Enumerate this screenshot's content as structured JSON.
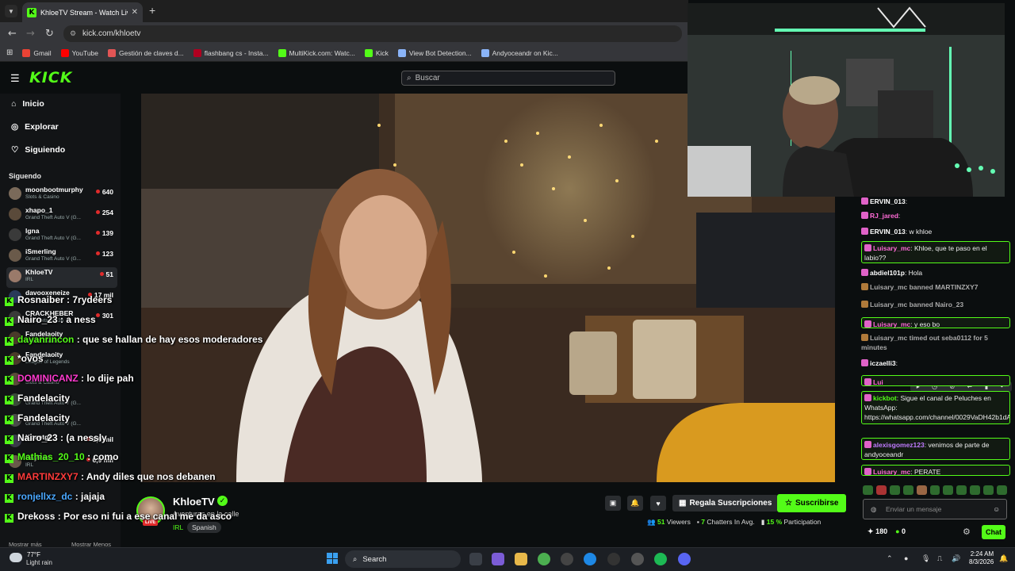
{
  "browser": {
    "tab_title": "KhloeTV Stream - Watch Liv",
    "new_tab": "+",
    "url": "kick.com/khloetv",
    "bookmarks": [
      {
        "label": "Gmail",
        "color": "#ea4335"
      },
      {
        "label": "YouTube",
        "color": "#ff0000"
      },
      {
        "label": "Gestión de claves d...",
        "color": "#e25555"
      },
      {
        "label": "flashbang cs - Insta...",
        "color": "#b00020"
      },
      {
        "label": "MultiKick.com: Watc...",
        "color": "#53fc18"
      },
      {
        "label": "Kick",
        "color": "#53fc18"
      },
      {
        "label": "View Bot Detection...",
        "color": "#8ab4f8"
      },
      {
        "label": "Andyoceandr on Kic...",
        "color": "#8ab4f8"
      }
    ]
  },
  "kick": {
    "logo": "KICK",
    "search_placeholder": "Buscar",
    "nav": [
      {
        "label": "Inicio",
        "icon": "home-icon"
      },
      {
        "label": "Explorar",
        "icon": "compass-icon"
      },
      {
        "label": "Siguiendo",
        "icon": "heart-icon"
      }
    ],
    "following_header": "Siguendo",
    "following": [
      {
        "name": "moonbootmurphy",
        "category": "Slots & Casino",
        "viewers": "640",
        "color": "#7a6a5a"
      },
      {
        "name": "xhapo_1",
        "category": "Grand Theft Auto V (G...",
        "viewers": "254",
        "color": "#5a4a3a"
      },
      {
        "name": "lgna",
        "category": "Grand Theft Auto V (G...",
        "viewers": "139",
        "color": "#3a3a3a"
      },
      {
        "name": "iSmerling",
        "category": "Grand Theft Auto V (G...",
        "viewers": "123",
        "color": "#6a5a4a"
      },
      {
        "name": "KhloeTV",
        "category": "IRL",
        "viewers": "51",
        "color": "#9a7a6a",
        "selected": true
      },
      {
        "name": "davooxeneize",
        "category": "",
        "viewers": "17 mil",
        "color": "#2a3a5a"
      },
      {
        "name": "CRACKHEBER",
        "category": "EA Sports FC 26",
        "viewers": "301",
        "color": "#3a3a3a"
      },
      {
        "name": "Fandelaoity",
        "category": "Slots & Casino",
        "viewers": "",
        "color": "#4a3a2a"
      },
      {
        "name": "Fandelaoity",
        "category": "League of Legends",
        "viewers": "",
        "color": "#4a3a2a"
      },
      {
        "name": "",
        "category": "Slots & Casino",
        "viewers": "",
        "color": "#5a4a3a"
      },
      {
        "name": "",
        "category": "Grand Theft Auto V (G...",
        "viewers": "",
        "color": "#3a4a3a"
      },
      {
        "name": "",
        "category": "Grand Theft Auto V (G...",
        "viewers": "",
        "color": "#4a4a4a"
      },
      {
        "name": "Konetgr",
        "category": "",
        "viewers": "1,9 mil",
        "color": "#3a3a4a"
      },
      {
        "name": "SoyPan",
        "category": "IRL",
        "viewers": "6,9 mil",
        "color": "#6a5a4a"
      }
    ],
    "show_more": "Mostrar más",
    "show_less": "Mostrar Menos"
  },
  "overlay_chat": [
    {
      "user": "Rosnaiber",
      "text": " : 7rydeers",
      "color": "#ffffff"
    },
    {
      "user": "Nairo_23",
      "text": " : a ness",
      "color": "#ffffff"
    },
    {
      "user": "dayanrincon",
      "text": " : que se hallan de hay esos moderadores",
      "color": "#53fc18"
    },
    {
      "user": "*ovos",
      "text": "",
      "color": "#ffffff"
    },
    {
      "user": "DOMINICANZ",
      "text": " : lo dije pah",
      "color": "#ff3bd0"
    },
    {
      "user": "Fandelacity",
      "text": "",
      "color": "#ffffff"
    },
    {
      "user": "Fandelacity",
      "text": "",
      "color": "#ffffff"
    },
    {
      "user": "Nairo_23",
      "text": " : (a nessly",
      "color": "#ffffff"
    },
    {
      "user": "Mathias_20_10",
      "text": " : como",
      "color": "#53fc18"
    },
    {
      "user": "MARTINZXY7",
      "text": " : Andy diles que nos debanen",
      "color": "#ff3b3b"
    },
    {
      "user": "ronjellxz_dc",
      "text": " : jajaja",
      "color": "#4aa8ff"
    },
    {
      "user": "Drekoss",
      "text": " : Por eso ni fui a ese canal me da asco",
      "color": "#ffffff"
    }
  ],
  "stream": {
    "channel": "KhloeTV",
    "live_badge": "LIVE",
    "title": "Aventuras en la calle",
    "category": "IRL",
    "language": "Spanish",
    "gift_label": "Regala Suscripciones",
    "subscribe_label": "Suscribirse",
    "viewers_value": "51",
    "viewers_label": " Viewers",
    "chatters_value": "7",
    "chatters_label": " Chatters In Avg.",
    "participation_value": "15 %",
    "participation_label": " Participation"
  },
  "chat": {
    "messages": [
      {
        "user": "ERVIN_013",
        "text": ":",
        "color": "#ffffff"
      },
      {
        "user": "RJ_jared",
        "text": ":",
        "color": "#ff6bd6"
      },
      {
        "user": "ERVIN_013",
        "text": ": w khloe",
        "color": "#ffffff"
      },
      {
        "user": "Luisary_mc",
        "text": ": Khloe, que te paso en el labio??",
        "color": "#ff6bd6",
        "highlight": true
      },
      {
        "user": "abdiel101p",
        "text": ": Hola",
        "color": "#ffffff"
      },
      {
        "user": "Luisary_mc banned MARTINZXY7",
        "text": "",
        "color": "#aaaaaa",
        "system": true
      },
      {
        "user": "Luisary_mc banned Nairo_23",
        "text": "",
        "color": "#aaaaaa",
        "system": true
      },
      {
        "user": "Luisary_mc",
        "text": ": y eso bo",
        "color": "#ff6bd6",
        "highlight": true
      },
      {
        "user": "Luisary_mc timed out seba0112 for 5 minutes",
        "text": "",
        "color": "#aaaaaa",
        "system": true
      },
      {
        "user": "iczaelli3",
        "text": ":",
        "color": "#ffffff"
      },
      {
        "user": "Lui",
        "text": "",
        "color": "#ff6bd6",
        "highlight": true
      },
      {
        "user": "kickbot",
        "text": ": Sigue el canal de Peluches en WhatsApp: https://whatsapp.com/channel/0029VaDH42b1dAwC4Pu5C70r",
        "color": "#53fc18",
        "highlight": true
      },
      {
        "user": "alexisgomez123",
        "text": ": venimos de parte de andyoceandr",
        "color": "#c07bff",
        "highlight": true
      },
      {
        "user": "Luisary_mc",
        "text": ": PERATE",
        "color": "#ff6bd6",
        "highlight": true
      }
    ],
    "input_placeholder": "Enviar un mensaje",
    "points": "180",
    "count": "0",
    "chat_button": "Chat"
  },
  "taskbar": {
    "temp": "77°F",
    "condition": "Light rain",
    "search": "Search",
    "time": "2:24 AM",
    "date": "8/3/2026"
  }
}
